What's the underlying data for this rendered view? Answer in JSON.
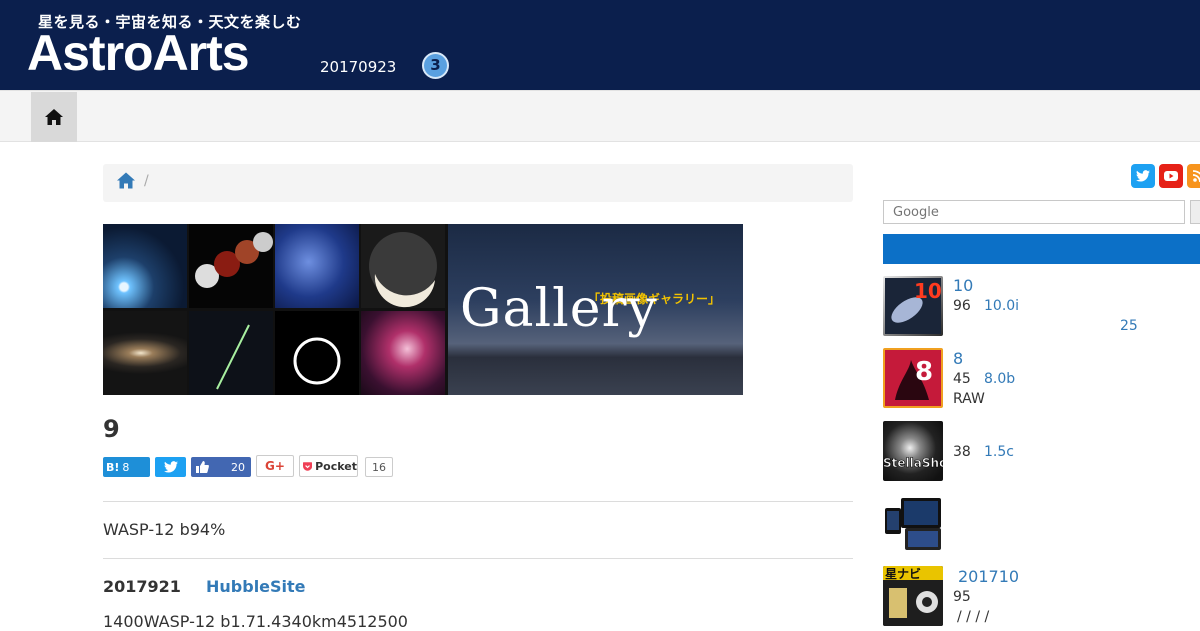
{
  "header": {
    "tagline": "星を見る・宇宙を知る・天文を楽しむ",
    "logo": "AstroArts",
    "date": "20170923",
    "badge": "3"
  },
  "nav": {
    "home_icon": "home-icon"
  },
  "breadcrumb": {
    "separator": "/"
  },
  "banner": {
    "gallery_word": "Gallery",
    "gallery_tag": "「投稿画像ギャラリー」"
  },
  "article": {
    "title": "9",
    "share": {
      "hatena_label": "B!",
      "hatena_count": "8",
      "facebook_count": "20",
      "gplus_label": "G+",
      "pocket_label": "Pocket",
      "pocket_count": "16"
    },
    "lead": "WASP-12 b94%",
    "date": "2017921",
    "source": "HubbleSite",
    "body": "1400WASP-12 b1.71.4340km4512500"
  },
  "sidebar": {
    "search_placeholder": "Google",
    "products": [
      {
        "title": "10",
        "line1_num": "96",
        "line1_link": "10.0i",
        "line2_link": "25"
      },
      {
        "title": "8",
        "line1_num": "45",
        "line1_link": "8.0b",
        "line2_text": "RAW"
      },
      {
        "line1_num": "38",
        "line1_link": "1.5c"
      },
      {},
      {
        "title": "201710",
        "line1_num": "95",
        "line2_text": "/ / / /"
      }
    ]
  },
  "colors": {
    "header_bg": "#0b1f4d",
    "link": "#337ab7",
    "sidebar_bar": "#0c70c7"
  }
}
